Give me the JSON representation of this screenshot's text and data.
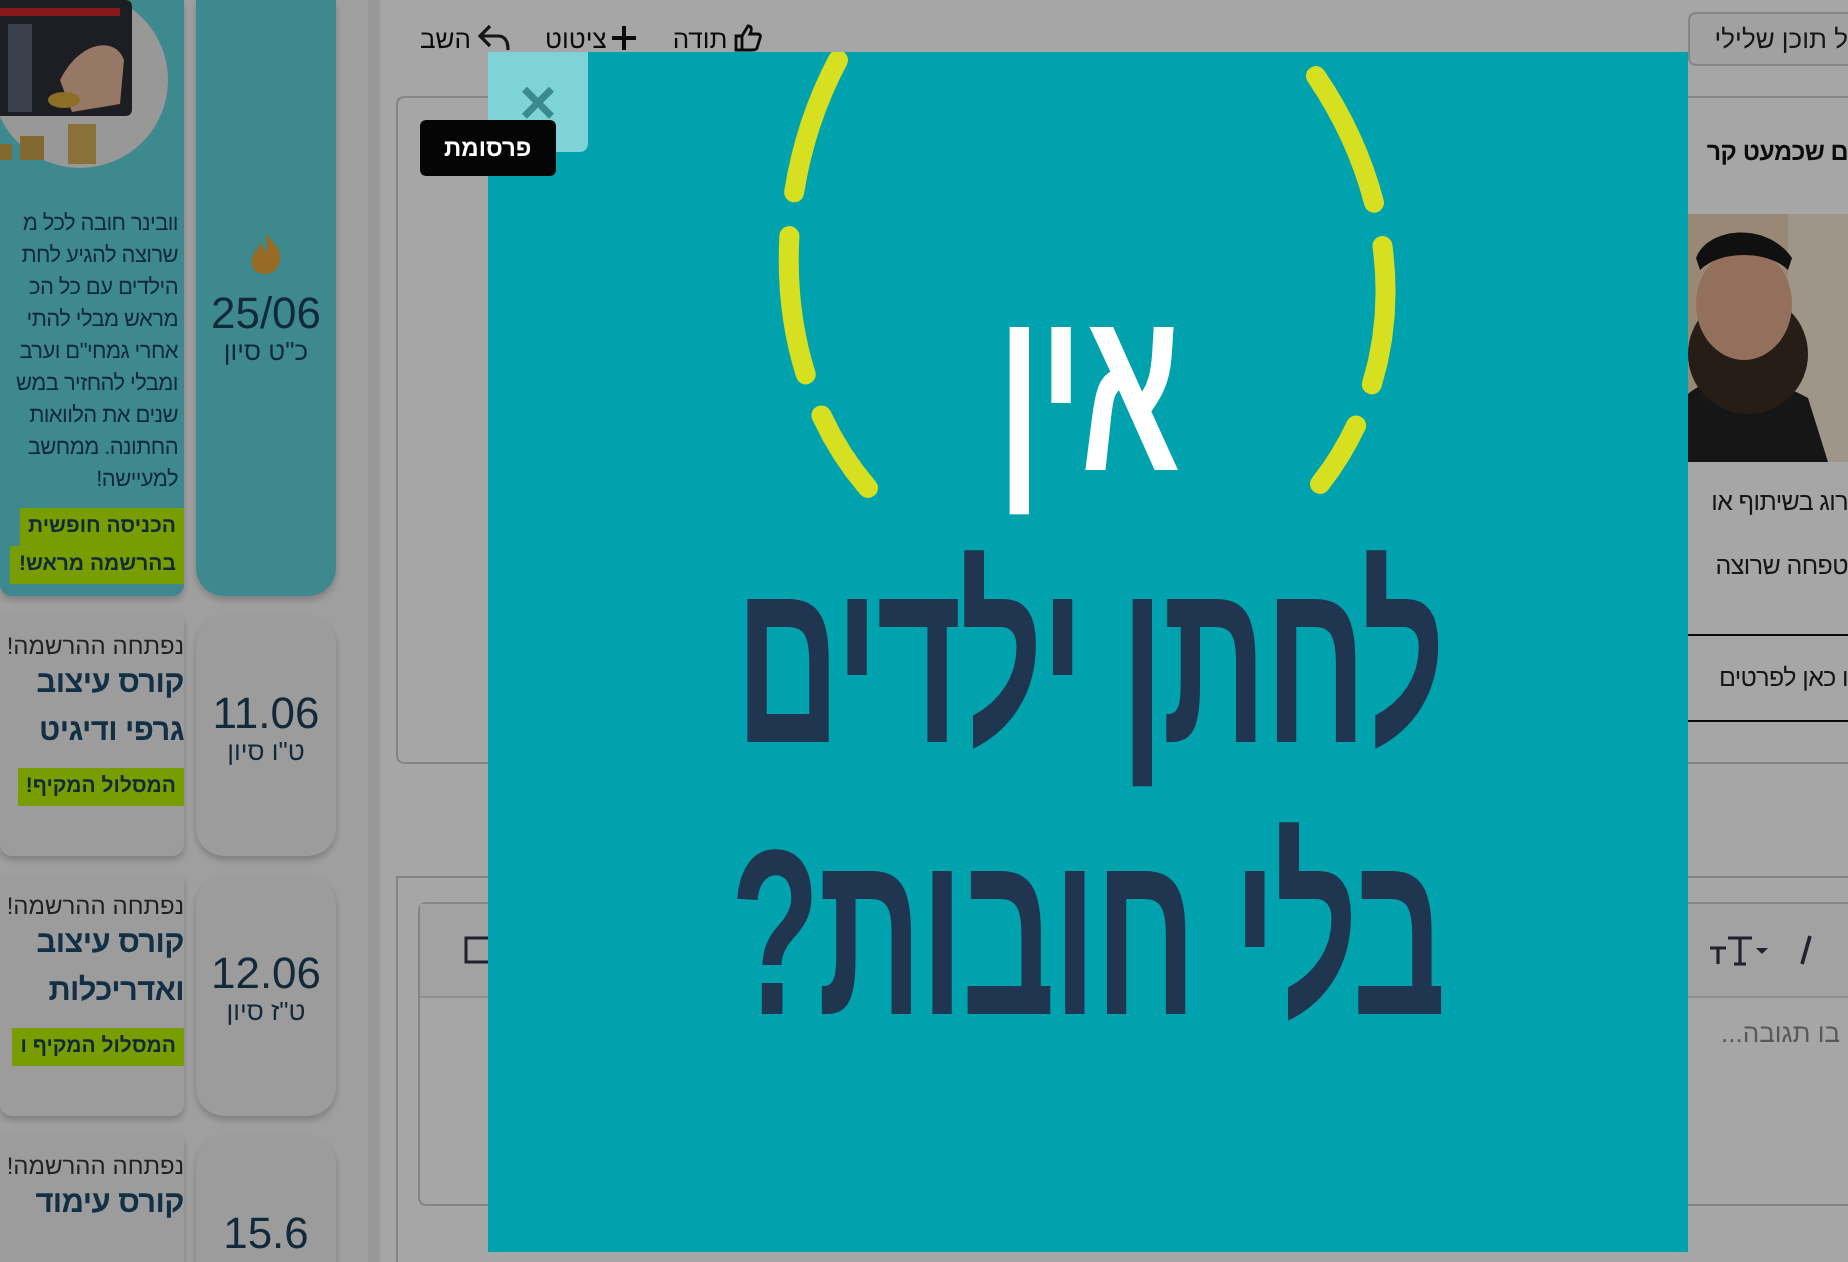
{
  "events": [
    {
      "kind": "promo",
      "lines": [
        "וובינר חובה לכל מ",
        "שרוצה להגיע לחת",
        "הילדים עם כל הכ",
        "מראש מבלי להתי",
        "אחרי גמחי\"ם וערב",
        "ומבלי להחזיר במש",
        "שנים את הלוואות",
        "החתונה. ממחשב",
        "למעיישה!"
      ],
      "tags": [
        "הכניסה חופשית",
        "בהרשמה מראש!"
      ],
      "date": "25/06",
      "hebrew_date": "כ\"ט סיון"
    },
    {
      "kind": "course",
      "status": "נפתחה ההרשמה!",
      "title_lines": [
        "קורס עיצוב",
        "גרפי ודיגיט"
      ],
      "tags": [
        "המסלול המקיף!"
      ],
      "date": "11.06",
      "hebrew_date": "ט\"ו סיון"
    },
    {
      "kind": "course",
      "status": "נפתחה ההרשמה!",
      "title_lines": [
        "קורס עיצוב",
        "ואדריכלות"
      ],
      "tags": [
        "המסלול המקיף ו"
      ],
      "date": "12.06",
      "hebrew_date": "ט\"ז סיון"
    },
    {
      "kind": "course",
      "status": "נפתחה ההרשמה!",
      "title_lines": [
        "קורס עימוד"
      ],
      "date": "15.6"
    }
  ],
  "post_actions": [
    {
      "kind": "thanks",
      "label": "תודה"
    },
    {
      "kind": "quote",
      "label": "ציטוט"
    },
    {
      "kind": "reply",
      "label": "השב"
    }
  ],
  "report_button": "ל תוכן שלילי",
  "post": {
    "title": "ם שכמעט קר",
    "body_lines": [
      "רוג בשיתוף או",
      "טפחה שרוצה"
    ],
    "link": "ו כאן לפרטים"
  },
  "editor": {
    "placeholder": "בו תגובה..."
  },
  "ad": {
    "label": "פרסומת",
    "close": "×",
    "headline": [
      "אין",
      "לחתן ילדים",
      "בלי חובות?"
    ]
  }
}
